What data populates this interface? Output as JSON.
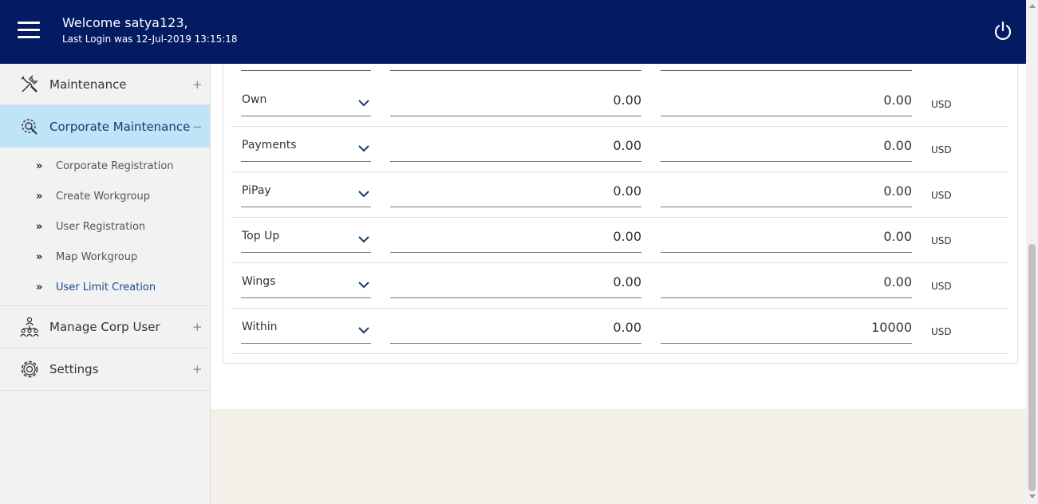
{
  "header": {
    "welcome": "Welcome satya123,",
    "last_login": "Last Login was 12-Jul-2019 13:15:18",
    "bg_color": "#031b62"
  },
  "sidebar": {
    "items": [
      {
        "label": "Maintenance",
        "toggle": "+",
        "icon": "tools-icon"
      },
      {
        "label": "Corporate Maintenance",
        "toggle": "−",
        "icon": "gear-search-icon",
        "active": true
      },
      {
        "label": "Manage Corp User",
        "toggle": "+",
        "icon": "org-chart-icon"
      },
      {
        "label": "Settings",
        "toggle": "+",
        "icon": "gear-icon"
      }
    ],
    "subitems": [
      {
        "label": "Corporate Registration"
      },
      {
        "label": "Create Workgroup"
      },
      {
        "label": "User Registration"
      },
      {
        "label": "Map Workgroup"
      },
      {
        "label": "User Limit Creation",
        "current": true
      }
    ],
    "sub_chevron": "»"
  },
  "limits": {
    "currency": "USD",
    "rows": [
      {
        "type": "Own",
        "min": "0.00",
        "max": "0.00",
        "currency": "USD"
      },
      {
        "type": "Payments",
        "min": "0.00",
        "max": "0.00",
        "currency": "USD"
      },
      {
        "type": "PiPay",
        "min": "0.00",
        "max": "0.00",
        "currency": "USD"
      },
      {
        "type": "Top Up",
        "min": "0.00",
        "max": "0.00",
        "currency": "USD"
      },
      {
        "type": "Wings",
        "min": "0.00",
        "max": "0.00",
        "currency": "USD"
      },
      {
        "type": "Within",
        "min": "0.00",
        "max": "10000",
        "currency": "USD"
      }
    ]
  },
  "colors": {
    "active_menu": "#bfe3f7",
    "accent": "#1b4a8c",
    "footer_bg": "#f3f0ea"
  }
}
